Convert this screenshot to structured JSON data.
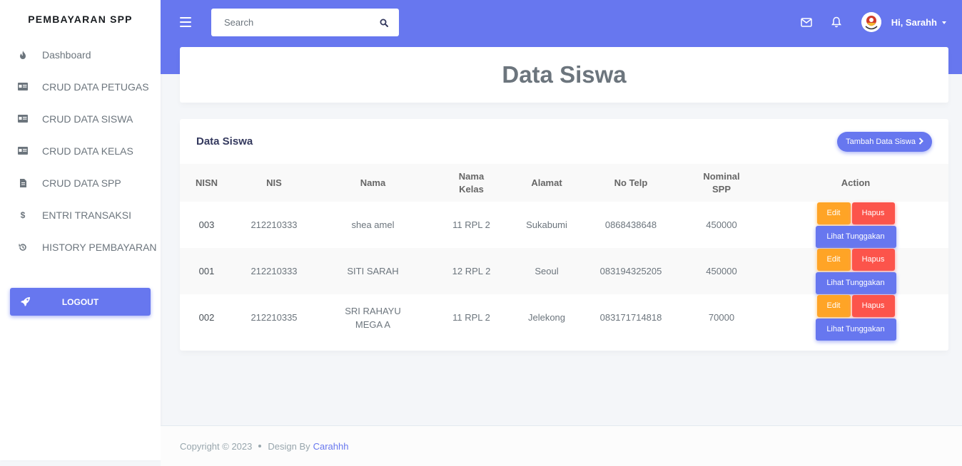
{
  "sidebar": {
    "brand": "PEMBAYARAN SPP",
    "items": [
      {
        "label": "Dashboard",
        "icon": "fire-icon"
      },
      {
        "label": "CRUD DATA PETUGAS",
        "icon": "id-card-icon"
      },
      {
        "label": "CRUD DATA SISWA",
        "icon": "id-card-icon"
      },
      {
        "label": "CRUD DATA KELAS",
        "icon": "id-card-icon"
      },
      {
        "label": "CRUD DATA SPP",
        "icon": "file-invoice-icon"
      },
      {
        "label": "ENTRI TRANSAKSI",
        "icon": "dollar-icon"
      },
      {
        "label": "HISTORY PEMBAYARAN",
        "icon": "history-icon"
      }
    ],
    "logout_label": "LOGOUT"
  },
  "navbar": {
    "search_placeholder": "Search",
    "user_greeting": "Hi, Sarahh"
  },
  "header": {
    "title": "Data Siswa"
  },
  "card": {
    "title": "Data Siswa",
    "add_button": "Tambah Data Siswa",
    "columns": [
      "NISN",
      "NIS",
      "Nama",
      "Nama Kelas",
      "Alamat",
      "No Telp",
      "Nominal SPP",
      "Action"
    ],
    "columns_display": [
      "NISN",
      "NIS",
      "Nama",
      "Nama\nKelas",
      "Alamat",
      "No Telp",
      "Nominal\nSPP",
      "Action"
    ],
    "rows": [
      {
        "nisn": "003",
        "nis": "212210333",
        "nama": "shea amel",
        "kelas": "11 RPL 2",
        "alamat": "Sukabumi",
        "telp": "0868438648",
        "nominal": "450000"
      },
      {
        "nisn": "001",
        "nis": "212210333",
        "nama": "SITI SARAH",
        "kelas": "12 RPL 2",
        "alamat": "Seoul",
        "telp": "083194325205",
        "nominal": "450000"
      },
      {
        "nisn": "002",
        "nis": "212210335",
        "nama": "SRI RAHAYU MEGA A",
        "kelas": "11 RPL 2",
        "alamat": "Jelekong",
        "telp": "083171714818",
        "nominal": "70000"
      }
    ],
    "btn_edit": "Edit",
    "btn_hapus": "Hapus",
    "btn_lihat": "Lihat Tunggakan"
  },
  "footer": {
    "copyright": "Copyright © 2023",
    "design_by": "Design By",
    "author": "Carahhh"
  },
  "colors": {
    "primary": "#6777ef",
    "warning": "#ffa426",
    "danger": "#fc544b"
  }
}
